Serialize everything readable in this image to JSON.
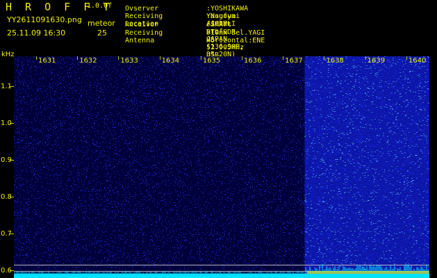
{
  "header": {
    "app_title": "H R O F F T",
    "app_version": "1.0.0f",
    "file_name": "YY2611091630.png",
    "datetime": "25.11.09 16:30",
    "meteor_label": "meteor",
    "meteor_count": "25"
  },
  "station": [
    {
      "label": "Ovserver",
      "value": ":YOSHIKAWA Yasufumi /JG2MLI"
    },
    {
      "label": "Receiving Location",
      "value": ":Nagoya Aichi-pref. JAPAN (136.90E, 35.20N)"
    },
    {
      "label": "Receiver",
      "value": ":SMArt RTL-SDR V5 52.905MHz USB TACHIKAWA"
    },
    {
      "label": "Receiving Antenna",
      "value": ":10mH 3el.YAGI Horizontal:ENE"
    }
  ],
  "axes": {
    "unit": "kHz",
    "y_ticks": [
      {
        "label": "1.1",
        "value": 1.1
      },
      {
        "label": "1.0",
        "value": 1.0
      },
      {
        "label": "0.9",
        "value": 0.9
      },
      {
        "label": "0.8",
        "value": 0.8
      },
      {
        "label": "0.7",
        "value": 0.7
      },
      {
        "label": "0.6",
        "value": 0.6
      }
    ],
    "x_ticks": [
      "1631",
      "1632",
      "1633",
      "1634",
      "1635",
      "1636",
      "1637",
      "1638",
      "1639",
      "1640"
    ]
  },
  "colors": {
    "text": "#f0f000",
    "background": "#000000",
    "noise_low": "#00003a",
    "noise_high": "#1e2cff",
    "signal": "#00e0ff"
  },
  "chart_data": {
    "type": "heatmap",
    "x_label": "",
    "y_label": "kHz",
    "ylim": [
      0.58,
      1.18
    ],
    "x_categories": [
      "1631",
      "1632",
      "1633",
      "1634",
      "1635",
      "1636",
      "1637",
      "1638",
      "1639",
      "1640"
    ],
    "x_range": [
      "16:30",
      "16:40"
    ],
    "high_noise_start": "1638",
    "horizontal_lines_khz": [
      0.615,
      0.598
    ],
    "grid": false
  }
}
